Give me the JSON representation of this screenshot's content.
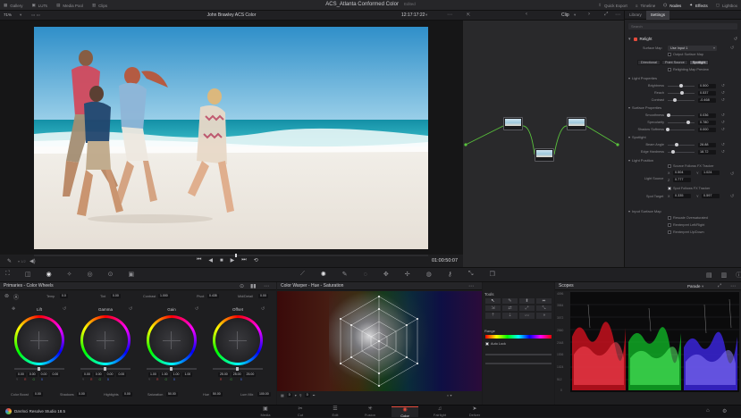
{
  "topbar": {
    "left_items": [
      {
        "icon": "gallery-icon",
        "label": "Gallery"
      },
      {
        "icon": "lut-icon",
        "label": "LUTs"
      },
      {
        "icon": "media-pool-icon",
        "label": "Media Pool"
      },
      {
        "icon": "clips-icon",
        "label": "Clips"
      }
    ],
    "title": "ACS_Atlanta Conformed Color",
    "title_sub": "Edited",
    "right_items": [
      {
        "icon": "quick-export-icon",
        "label": "Quick Export",
        "active": false
      },
      {
        "icon": "timeline-icon",
        "label": "Timeline",
        "active": false
      },
      {
        "icon": "nodes-icon",
        "label": "Nodes",
        "active": true
      },
      {
        "icon": "effects-icon",
        "label": "Effects",
        "active": true
      },
      {
        "icon": "lightbox-icon",
        "label": "Lightbox",
        "active": false
      }
    ]
  },
  "viewer": {
    "zoom": "71%",
    "clip_name": "John Brawley ACS Color",
    "timecode": "12:17:17:22",
    "playhead_timecode": "01:00:50:07"
  },
  "nodebar": {
    "mode_label": "Clip"
  },
  "inspector": {
    "tabs": [
      "Library",
      "Settings"
    ],
    "active_tab": "Settings",
    "search_placeholder": "Search",
    "effect_name": "Relight",
    "surface_map": {
      "label": "Surface Map",
      "value": "Use Input 1",
      "output_label": "Output Surface Map"
    },
    "light_modes": [
      "Directional",
      "Point Source",
      "Spotlight"
    ],
    "active_light_mode": "Spotlight",
    "relighting_preview": "Relighting Map Preview",
    "sections": {
      "light_properties": "Light Properties",
      "surface_properties": "Surface Properties",
      "spotlight": "Spotlight",
      "light_position": "Light Position",
      "input_surface_map": "Input Surface Map"
    },
    "light_props": [
      {
        "label": "Brightness",
        "value": "0.500",
        "pos": 0.5
      },
      {
        "label": "Reach",
        "value": "0.537",
        "pos": 0.54
      },
      {
        "label": "Contrast",
        "value": "-0.468",
        "pos": 0.27
      }
    ],
    "surface_props": [
      {
        "label": "Smoothness",
        "value": "0.036",
        "pos": 0.04
      },
      {
        "label": "Specularity",
        "value": "0.780",
        "pos": 0.78
      },
      {
        "label": "Shadow Softness",
        "value": "0.000",
        "pos": 0.0
      }
    ],
    "spotlight_props": [
      {
        "label": "Beam Angle",
        "value": "28.88",
        "pos": 0.32
      },
      {
        "label": "Edge Hardness",
        "value": "18.72",
        "pos": 0.19
      }
    ],
    "light_source_label": "Light Source",
    "source_tracker": "Source Follows FX Tracker",
    "light_source_xyz": [
      {
        "axis": "X",
        "value": "0.504"
      },
      {
        "axis": "Y",
        "value": "1.024"
      },
      {
        "axis": "Z",
        "value": "0.777"
      }
    ],
    "spot_tracker": "Spot Follows FX Tracker",
    "spot_target_label": "Spot Target",
    "spot_target": [
      {
        "axis": "X",
        "value": "0.335"
      },
      {
        "axis": "Y",
        "value": "0.597"
      }
    ],
    "surface_map_options": [
      "Rescale Oversaturated",
      "Renterpret Left/Right",
      "Renterpret Up/Down"
    ]
  },
  "primaries": {
    "title": "Primaries - Color Wheels",
    "top_params": [
      {
        "label": "Temp",
        "value": "0.0"
      },
      {
        "label": "Tint",
        "value": "0.00"
      },
      {
        "label": "Contrast",
        "value": "1.000"
      },
      {
        "label": "Pivot",
        "value": "0.435"
      },
      {
        "label": "Mid/Detail",
        "value": "0.00"
      }
    ],
    "wheels": [
      {
        "name": "Lift",
        "values": [
          "0.00",
          "0.00",
          "0.00",
          "0.00"
        ]
      },
      {
        "name": "Gamma",
        "values": [
          "0.00",
          "0.00",
          "0.00",
          "0.00"
        ]
      },
      {
        "name": "Gain",
        "values": [
          "1.00",
          "1.00",
          "1.00",
          "1.00"
        ]
      },
      {
        "name": "Offset",
        "values": [
          "25.00",
          "25.00",
          "25.00",
          ""
        ]
      }
    ],
    "bottom_params": [
      {
        "label": "Color Boost",
        "value": "0.00"
      },
      {
        "label": "Shadows",
        "value": "0.00"
      },
      {
        "label": "Highlights",
        "value": "0.00"
      },
      {
        "label": "Saturation",
        "value": "50.00"
      },
      {
        "label": "Hue",
        "value": "50.00"
      },
      {
        "label": "Lum Mix",
        "value": "100.00"
      }
    ]
  },
  "warper": {
    "title": "Color Warper - Hue - Saturation",
    "footer_values": [
      "0",
      "0"
    ]
  },
  "tools": {
    "title": "Tools",
    "range_label": "Range",
    "auto_lock": "Auto Lock"
  },
  "scopes": {
    "title": "Scopes",
    "mode": "Parade",
    "axis": [
      "4096",
      "3584",
      "3072",
      "2560",
      "2048",
      "1536",
      "1024",
      "512",
      "0"
    ]
  },
  "pagebar": {
    "app_name": "DaVinci Resolve Studio 18.5",
    "pages": [
      {
        "label": "Media",
        "icon": "media-page-icon",
        "active": false
      },
      {
        "label": "Cut",
        "icon": "cut-page-icon",
        "active": false
      },
      {
        "label": "Edit",
        "icon": "edit-page-icon",
        "active": false
      },
      {
        "label": "Fusion",
        "icon": "fusion-page-icon",
        "active": false
      },
      {
        "label": "Color",
        "icon": "color-page-icon",
        "active": true
      },
      {
        "label": "Fairlight",
        "icon": "fairlight-page-icon",
        "active": false
      },
      {
        "label": "Deliver",
        "icon": "deliver-page-icon",
        "active": false
      }
    ]
  }
}
